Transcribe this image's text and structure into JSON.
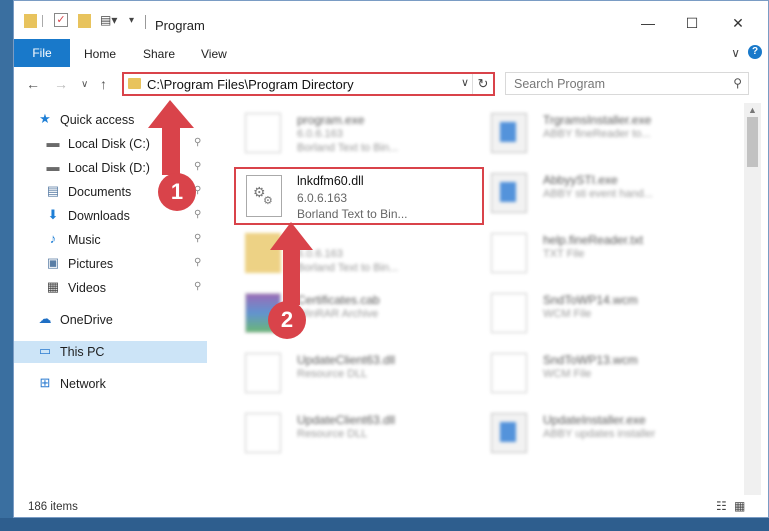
{
  "window": {
    "title": "Program",
    "controls": {
      "minimize": "—",
      "maximize": "☐",
      "close": "✕"
    }
  },
  "ribbon": {
    "tabs": [
      "File",
      "Home",
      "Share",
      "View"
    ],
    "expand_icon": "∨",
    "help": "?"
  },
  "navbar": {
    "back": "←",
    "forward": "→",
    "recent": "∨",
    "up": "↑",
    "address": "C:\\Program Files\\Program Directory",
    "dropdown": "∨",
    "refresh": "↻",
    "search_placeholder": "Search Program",
    "search_icon": "⚲"
  },
  "nav_pane": {
    "items": [
      {
        "label": "Quick access",
        "icon": "★",
        "color": "#1f7fd6",
        "pinned": false
      },
      {
        "label": "Local Disk (C:)",
        "icon": "▬",
        "color": "#6a6a6a",
        "pinned": true
      },
      {
        "label": "Local Disk (D:)",
        "icon": "▬",
        "color": "#6a6a6a",
        "pinned": true
      },
      {
        "label": "Documents",
        "icon": "▤",
        "color": "#5a7ea6",
        "pinned": true
      },
      {
        "label": "Downloads",
        "icon": "⬇",
        "color": "#1f7fd6",
        "pinned": true
      },
      {
        "label": "Music",
        "icon": "♪",
        "color": "#1f7fd6",
        "pinned": true
      },
      {
        "label": "Pictures",
        "icon": "▣",
        "color": "#5a7ea6",
        "pinned": true
      },
      {
        "label": "Videos",
        "icon": "▦",
        "color": "#444444",
        "pinned": true
      },
      {
        "label": "OneDrive",
        "icon": "☁",
        "color": "#1f6fc4",
        "pinned": false
      },
      {
        "label": "This PC",
        "icon": "▭",
        "color": "#2b7bd0",
        "pinned": false,
        "selected": true
      },
      {
        "label": "Network",
        "icon": "⊞",
        "color": "#2b7bd0",
        "pinned": false
      }
    ],
    "pin_icon": "📌"
  },
  "files": {
    "left": [
      {
        "name": "program.exe",
        "detail": "6.0.6.163",
        "sub": "Borland Text to Bin...",
        "kind": "exe"
      },
      {
        "name": "",
        "detail": "6.0.6.163",
        "sub": "Borland Text to Bin...",
        "kind": "folder"
      },
      {
        "name": "Certificates.cab",
        "detail": "WinRAR Archive",
        "sub": "",
        "kind": "rar"
      },
      {
        "name": "UpdateClient63.dll",
        "detail": "Resource DLL",
        "sub": "",
        "kind": "dll"
      },
      {
        "name": "UpdateClient63.dll",
        "detail": "Resource DLL",
        "sub": "",
        "kind": "dll"
      }
    ],
    "right": [
      {
        "name": "TrgramsInstaller.exe",
        "detail": "ABBY fineReader to...",
        "kind": "app"
      },
      {
        "name": "AbbyySTI.exe",
        "detail": "ABBY sti event hand...",
        "kind": "app"
      },
      {
        "name": "help.fineReader.txt",
        "detail": "TXT File",
        "kind": "doc"
      },
      {
        "name": "SndToWP14.wcm",
        "detail": "WCM File",
        "kind": "doc"
      },
      {
        "name": "SndToWP13.wcm",
        "detail": "WCM File",
        "kind": "doc"
      },
      {
        "name": "UpdateInstaller.exe",
        "detail": "ABBY updates installer",
        "kind": "app"
      }
    ],
    "highlighted": {
      "name": "lnkdfm60.dll",
      "version": "6.0.6.163",
      "description": "Borland Text to Bin..."
    }
  },
  "annotations": {
    "step1": "1",
    "step2": "2",
    "color": "#d9434a"
  },
  "status": {
    "item_count": "186 items"
  }
}
